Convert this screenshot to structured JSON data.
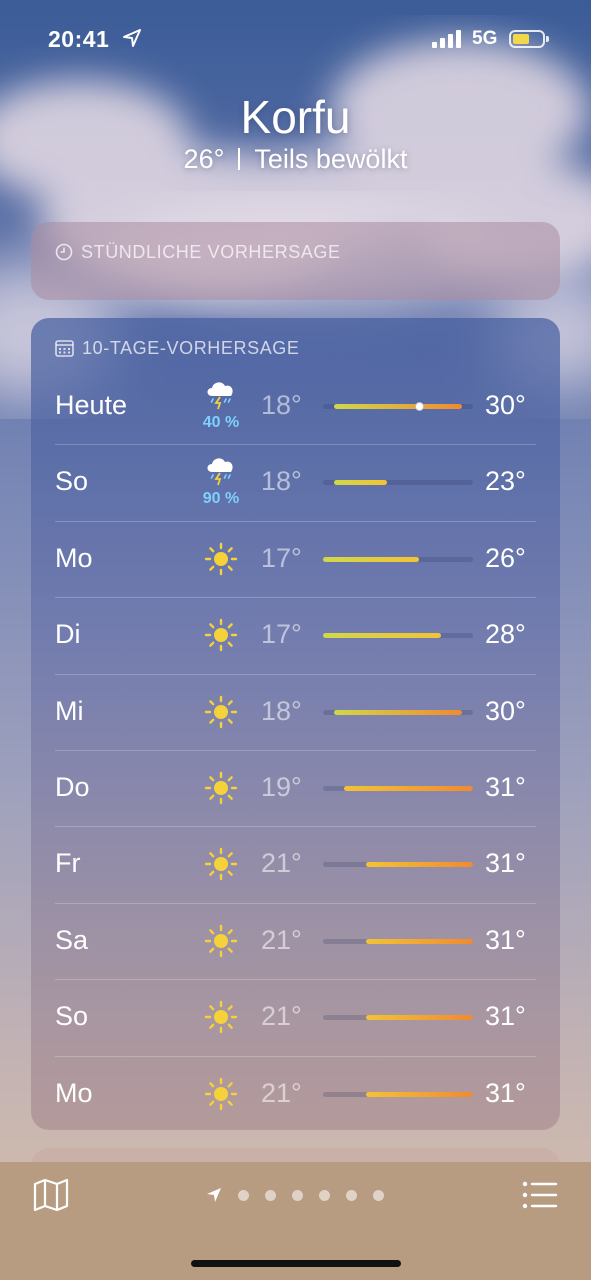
{
  "status": {
    "time": "20:41",
    "network": "5G"
  },
  "location": {
    "city": "Korfu",
    "temperature": "26°",
    "condition": "Teils bewölkt"
  },
  "hourly": {
    "title": "STÜNDLICHE VORHERSAGE"
  },
  "forecast": {
    "title": "10-TAGE-VORHERSAGE",
    "scale": {
      "min": 17,
      "max": 31
    },
    "current_temp": 26,
    "days": [
      {
        "day": "Heute",
        "icon": "thunderstorm-icon",
        "precip": "40 %",
        "low": "18°",
        "high": "30°",
        "low_val": 18,
        "high_val": 30
      },
      {
        "day": "So",
        "icon": "thunderstorm-icon",
        "precip": "90 %",
        "low": "18°",
        "high": "23°",
        "low_val": 18,
        "high_val": 23
      },
      {
        "day": "Mo",
        "icon": "sun-icon",
        "precip": "",
        "low": "17°",
        "high": "26°",
        "low_val": 17,
        "high_val": 26
      },
      {
        "day": "Di",
        "icon": "sun-icon",
        "precip": "",
        "low": "17°",
        "high": "28°",
        "low_val": 17,
        "high_val": 28
      },
      {
        "day": "Mi",
        "icon": "sun-icon",
        "precip": "",
        "low": "18°",
        "high": "30°",
        "low_val": 18,
        "high_val": 30
      },
      {
        "day": "Do",
        "icon": "sun-icon",
        "precip": "",
        "low": "19°",
        "high": "31°",
        "low_val": 19,
        "high_val": 31
      },
      {
        "day": "Fr",
        "icon": "sun-icon",
        "precip": "",
        "low": "21°",
        "high": "31°",
        "low_val": 21,
        "high_val": 31
      },
      {
        "day": "Sa",
        "icon": "sun-icon",
        "precip": "",
        "low": "21°",
        "high": "31°",
        "low_val": 21,
        "high_val": 31
      },
      {
        "day": "So",
        "icon": "sun-icon",
        "precip": "",
        "low": "21°",
        "high": "31°",
        "low_val": 21,
        "high_val": 31
      },
      {
        "day": "Mo",
        "icon": "sun-icon",
        "precip": "",
        "low": "21°",
        "high": "31°",
        "low_val": 21,
        "high_val": 31
      }
    ]
  },
  "colors": {
    "precip": "#7fd0ff",
    "sun": "#f5d13a",
    "cool": "#cfd84a",
    "mid": "#f2c335",
    "warm": "#f08a32"
  },
  "pager": {
    "count": 6,
    "active": 0
  },
  "icons": {
    "map": "map-icon",
    "list": "list-icon",
    "location": "location-arrow-icon"
  }
}
